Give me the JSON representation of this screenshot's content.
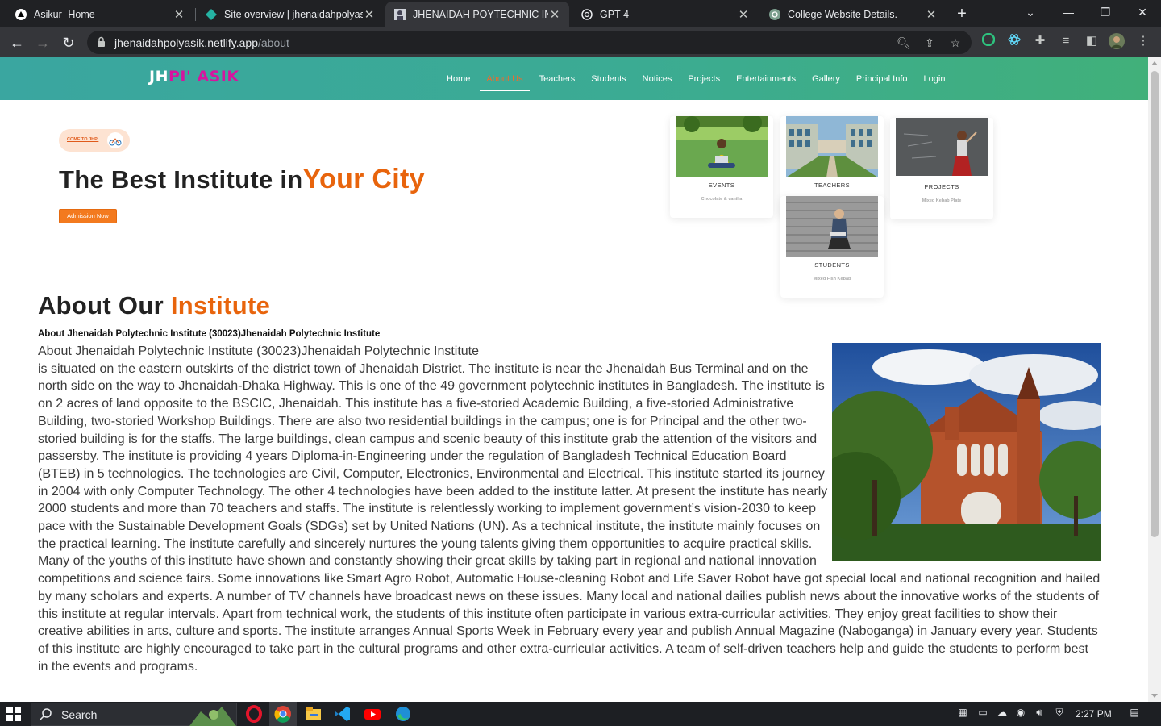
{
  "browser": {
    "tabs": [
      {
        "title": "Asikur -Home",
        "active": false,
        "icon": "triangle-icon"
      },
      {
        "title": "Site overview | jhenaidahpolyasik",
        "active": false,
        "icon": "netlify-icon"
      },
      {
        "title": "JHENAIDAH POYTECHNIC INSTITUTE",
        "active": true,
        "icon": "avatar-icon"
      },
      {
        "title": "GPT-4",
        "active": false,
        "icon": "openai-icon"
      },
      {
        "title": "College Website Details.",
        "active": false,
        "icon": "openai-icon"
      }
    ],
    "url_host": "jhenaidahpolyasik.netlify.app",
    "url_path": "/about"
  },
  "site": {
    "logo_part1": "JH",
    "logo_part2": "PI' ASIK",
    "nav": [
      "Home",
      "About Us",
      "Teachers",
      "Students",
      "Notices",
      "Projects",
      "Entertainments",
      "Gallery",
      "Principal Info",
      "Login"
    ],
    "nav_current": "About Us"
  },
  "hero": {
    "pill_text": "COME TO JHPI",
    "title_plain": "The Best Institute in",
    "title_accent": "Your City",
    "button": "Admission Now"
  },
  "cards": [
    {
      "caption": "EVENTS",
      "sub": "Chocolate & vanilla"
    },
    {
      "caption": "TEACHERS",
      "sub": ""
    },
    {
      "caption": "PROJECTS",
      "sub": "Mixed Kebab Plate"
    },
    {
      "caption": "STUDENTS",
      "sub": "Mixed Fish Kebab"
    }
  ],
  "about": {
    "heading_plain": "About Our ",
    "heading_accent": "Institute",
    "subheading": "About Jhenaidah Polytechnic Institute (30023)Jhenaidah Polytechnic Institute",
    "lead": "About Jhenaidah Polytechnic Institute (30023)Jhenaidah Polytechnic Institute",
    "body": "is situated on the eastern outskirts of the district town of Jhenaidah District. The institute is near the Jhenaidah Bus Terminal and on the north side on the way to Jhenaidah-Dhaka Highway. This is one of the 49 government polytechnic institutes in Bangladesh. The institute is on 2 acres of land opposite to the BSCIC, Jhenaidah. This institute has a five-storied Academic Building, a five-storied Administrative Building, two-storied Workshop Buildings. There are also two residential buildings in the campus; one is for Principal and the other two-storied building is for the staffs. The large buildings, clean campus and scenic beauty of this institute grab the attention of the visitors and passersby. The institute is providing 4 years Diploma-in-Engineering under the regulation of Bangladesh Technical Education Board (BTEB) in 5 technologies. The technologies are Civil, Computer, Electronics, Environmental and Electrical. This institute started its journey in 2004 with only Computer Technology. The other 4 technologies have been added to the institute latter. At present the institute has nearly 2000 students and more than 70 teachers and staffs. The institute is relentlessly working to implement government’s vision-2030 to keep pace with the Sustainable Development Goals (SDGs) set by United Nations (UN). As a technical institute, the institute mainly focuses on the practical learning. The institute carefully and sincerely nurtures the young talents giving them opportunities to acquire practical skills. Many of the youths of this institute have shown and constantly showing their great skills by taking part in regional and national innovation competitions and science fairs. Some innovations like Smart Agro Robot, Automatic House-cleaning Robot and Life Saver Robot have got special local and national recognition and hailed by many scholars and experts. A number of TV channels have broadcast news on these issues. Many local and national dailies publish news about the innovative works of the students of this institute at regular intervals. Apart from technical work, the students of this institute often participate in various extra-curricular activities. They enjoy great facilities to show their creative abilities in arts, culture and sports. The institute arranges Annual Sports Week in February every year and publish Annual Magazine (Naboganga) in January every year. Students of this institute are highly encouraged to take part in the cultural programs and other extra-curricular activities. A team of self-driven teachers help and guide the students to perform best in the events and programs."
  },
  "taskbar": {
    "search_label": "Search",
    "time": "2:27 PM"
  },
  "colors": {
    "accent": "#e8640c",
    "nav_gradient_start": "#3aa6a0",
    "nav_gradient_end": "#41b07a",
    "logo_pink": "#d6159f",
    "button": "#f37a1f"
  }
}
